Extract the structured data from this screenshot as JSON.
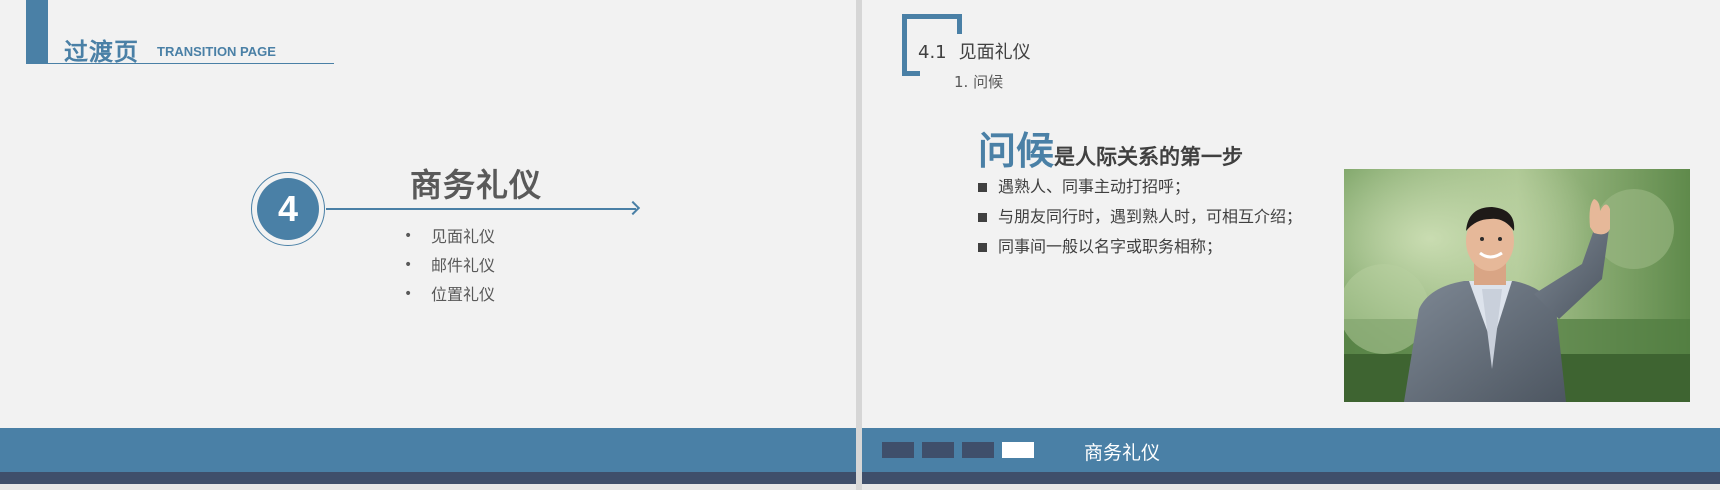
{
  "left_slide": {
    "header_title": "过渡页",
    "header_subtitle": "TRANSITION PAGE",
    "section_number": "4",
    "section_title": "商务礼仪",
    "items": [
      "见面礼仪",
      "邮件礼仪",
      "位置礼仪"
    ],
    "bullet": "•"
  },
  "right_slide": {
    "heading_number": "4.1",
    "heading_text": "见面礼仪",
    "sub_heading": "1. 问候",
    "title_big": "问候",
    "title_rest": "是人际关系的第一步",
    "points": [
      "遇熟人、同事主动打招呼；",
      "与朋友同行时，遇到熟人时，可相互介绍；",
      "同事间一般以名字或职务相称；"
    ],
    "footer_label": "商务礼仪",
    "nav_squares": [
      {
        "state": "inactive",
        "color": "#3f4f6b"
      },
      {
        "state": "inactive",
        "color": "#3f4f6b"
      },
      {
        "state": "inactive",
        "color": "#3f4f6b"
      },
      {
        "state": "active",
        "color": "#ffffff"
      }
    ]
  },
  "colors": {
    "accent": "#4a80a6",
    "dark_band": "#3f4f6b",
    "slide_bg": "#f2f2f2",
    "text": "#595959"
  }
}
